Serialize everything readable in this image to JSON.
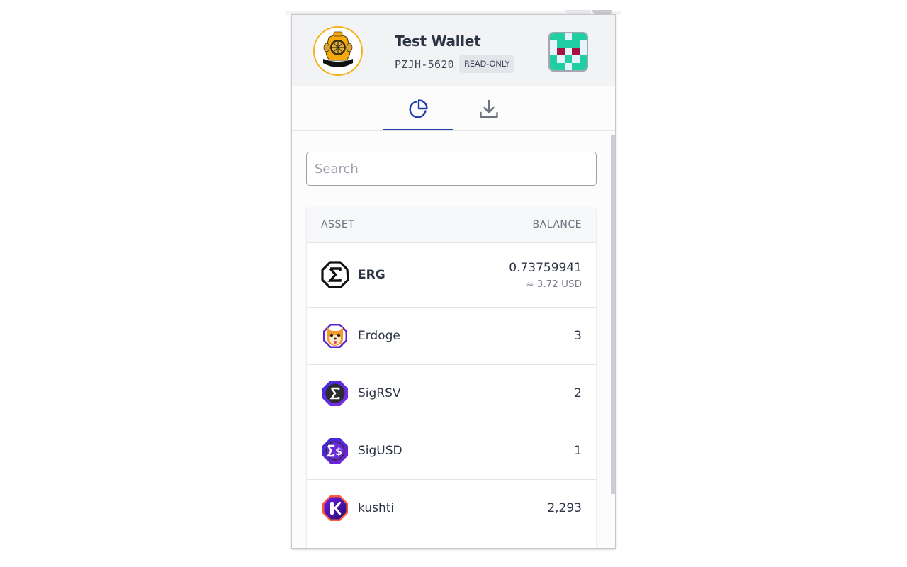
{
  "header": {
    "wallet_name": "Test Wallet",
    "wallet_id": "PZJH-5620",
    "badge": "READ-ONLY",
    "avatar_icon": "diving-helmet-icon",
    "identicon": {
      "colors": {
        "background": "#e6f3fa",
        "primary": "#1fcfa3",
        "accent": "#a4123f"
      }
    }
  },
  "tabs": [
    {
      "id": "assets",
      "icon": "pie-chart-icon",
      "active": true,
      "color": "#1e3fab"
    },
    {
      "id": "receive",
      "icon": "download-icon",
      "active": false,
      "color": "#6b7280"
    }
  ],
  "search": {
    "placeholder": "Search",
    "value": ""
  },
  "assets_table": {
    "columns": [
      "ASSET",
      "BALANCE"
    ],
    "rows": [
      {
        "name": "ERG",
        "icon": "ergo-icon",
        "amount": "0.73759941",
        "fiat": "≈ 3.72 USD"
      },
      {
        "name": "Erdoge",
        "icon": "erdoge-icon",
        "amount": "3"
      },
      {
        "name": "SigRSV",
        "icon": "sigrsv-icon",
        "amount": "2"
      },
      {
        "name": "SigUSD",
        "icon": "sigusd-icon",
        "amount": "1"
      },
      {
        "name": "kushti",
        "icon": "kushti-icon",
        "amount": "2,293"
      }
    ]
  }
}
